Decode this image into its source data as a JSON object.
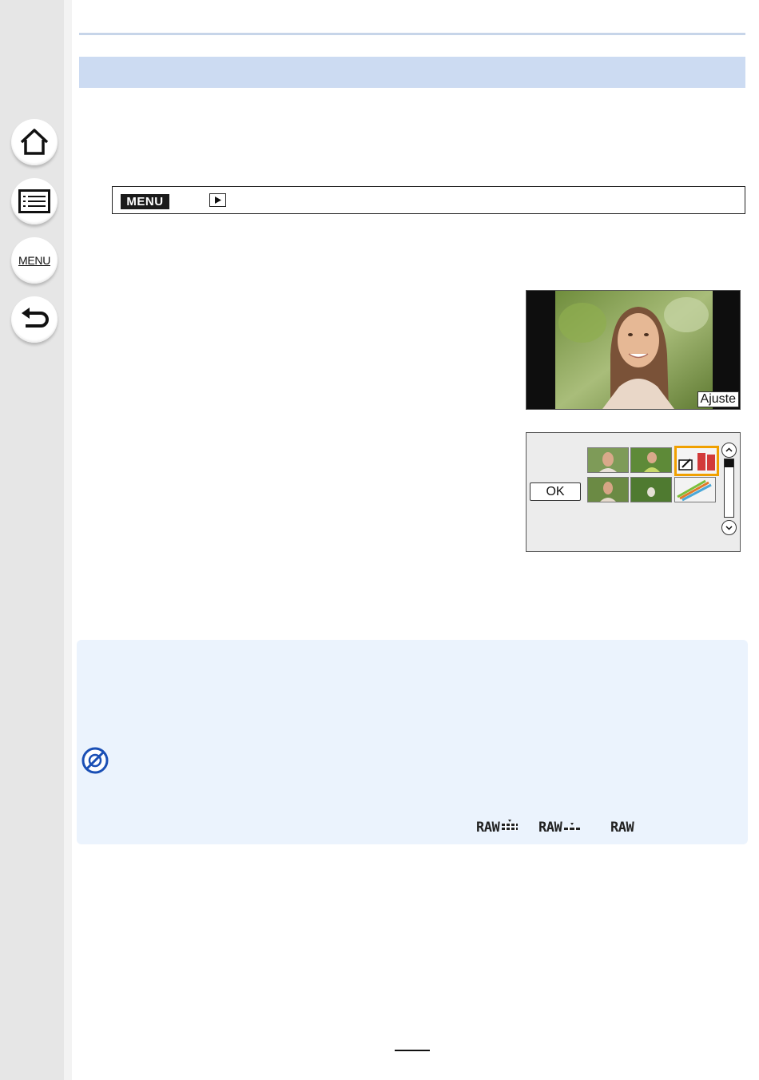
{
  "sidebar": {
    "items": [
      {
        "name": "home",
        "label": ""
      },
      {
        "name": "contents",
        "label": ""
      },
      {
        "name": "menu",
        "label": "MENU"
      },
      {
        "name": "back",
        "label": ""
      }
    ]
  },
  "menu_path": {
    "menu_chip": "MENU"
  },
  "screens": {
    "photo_tag": "Ajuste",
    "ok_label": "OK"
  },
  "notes": {
    "raw_labels": [
      "RAW",
      "RAW",
      "RAW"
    ]
  },
  "colors": {
    "sidebar": "#e6e6e6",
    "title_band": "#ccdbf2",
    "note_background": "#ebf3fd",
    "no_icon_blue": "#1a4fb5",
    "selection_orange": "#f0a000"
  }
}
